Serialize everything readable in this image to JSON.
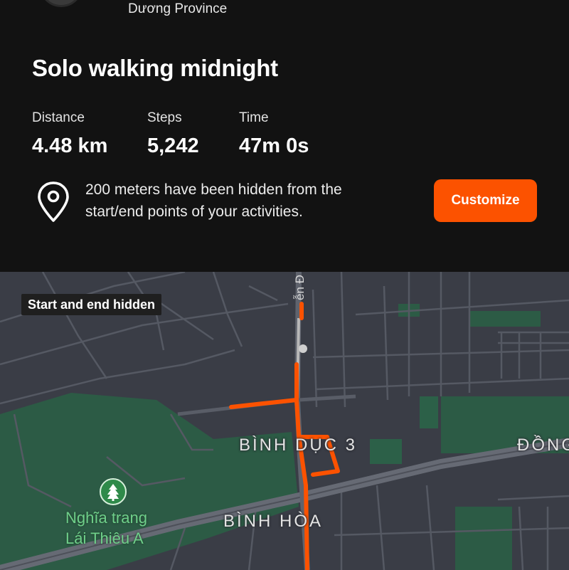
{
  "activity": {
    "location": "Dương Province",
    "title": "Solo walking midnight",
    "stats": [
      {
        "label": "Distance",
        "value": "4.48 km"
      },
      {
        "label": "Steps",
        "value": "5,242"
      },
      {
        "label": "Time",
        "value": "47m 0s"
      }
    ]
  },
  "privacy": {
    "notice_line1": "200 meters have been hidden from the",
    "notice_line2": "start/end points of your activities.",
    "customize_label": "Customize"
  },
  "map": {
    "hidden_chip": "Start and end hidden",
    "labels": {
      "binh_duc": "BÌNH DỤC 3",
      "binh_hoa": "BÌNH HÒA",
      "dong": "ĐỒNG",
      "street": "ễn Đ",
      "cemetery_line1": "Nghĩa trang",
      "cemetery_line2": "Lái Thiêu A"
    },
    "colors": {
      "route": "#fc5200",
      "background": "#3a3d46",
      "park": "#2c5b45",
      "road": "#5a5e68"
    }
  },
  "colors": {
    "accent": "#fc5200",
    "background": "#121212"
  }
}
